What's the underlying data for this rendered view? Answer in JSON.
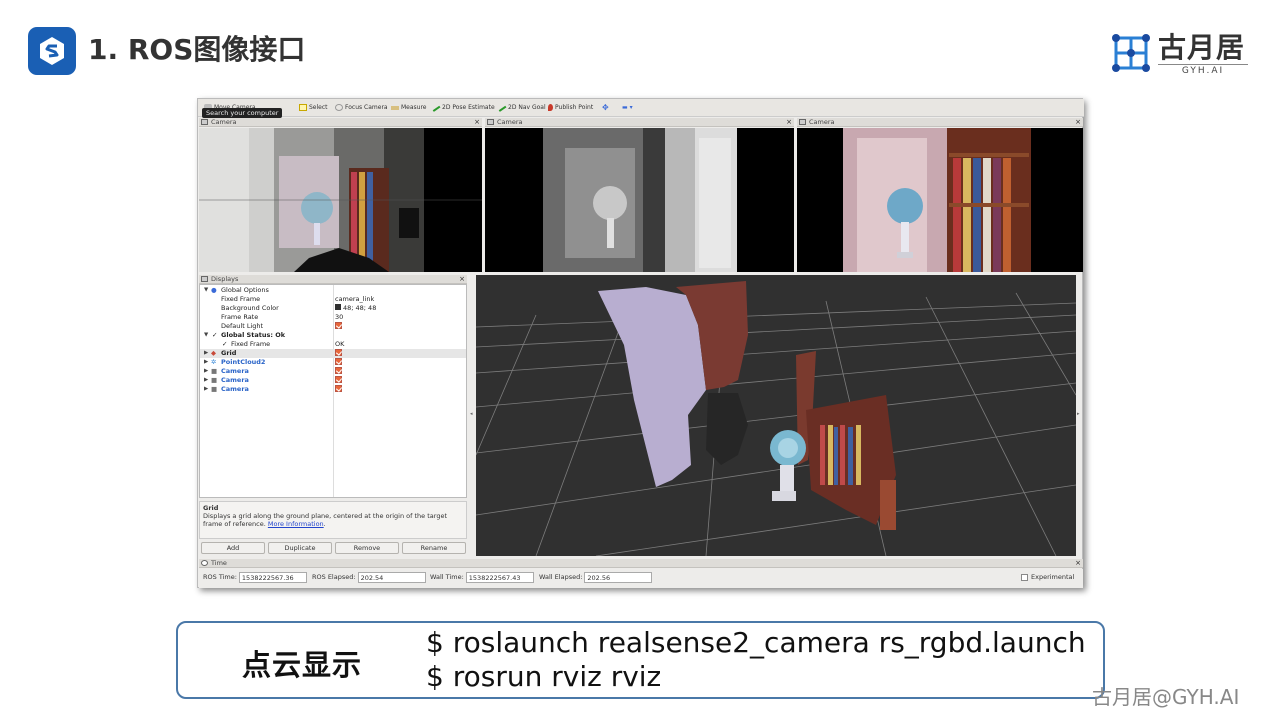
{
  "slide": {
    "title": "1. ROS图像接口",
    "brand_cn": "古月居",
    "brand_en": "GYH.AI",
    "watermark": "古月居@GYH.AI",
    "accent": "#1a5fb4",
    "box_border": "#4a78a8"
  },
  "rviz": {
    "toolbar": {
      "items": [
        "Move Camera",
        "Select",
        "Focus Camera",
        "Measure",
        "2D Pose Estimate",
        "2D Nav Goal",
        "Publish Point"
      ],
      "tooltip": "Search your computer"
    },
    "camera_panels": [
      "Camera",
      "Camera",
      "Camera"
    ],
    "displays": {
      "title": "Displays",
      "rows": [
        {
          "label": "Global Options",
          "value": ""
        },
        {
          "label": "Fixed Frame",
          "value": "camera_link"
        },
        {
          "label": "Background Color",
          "value": "48; 48; 48"
        },
        {
          "label": "Frame Rate",
          "value": "30"
        },
        {
          "label": "Default Light",
          "value": ""
        },
        {
          "label": "Global Status: Ok",
          "value": ""
        },
        {
          "label": "Fixed Frame",
          "value": "OK"
        },
        {
          "label": "Grid",
          "value": ""
        },
        {
          "label": "PointCloud2",
          "value": ""
        },
        {
          "label": "Camera",
          "value": ""
        },
        {
          "label": "Camera",
          "value": ""
        },
        {
          "label": "Camera",
          "value": ""
        }
      ],
      "description_title": "Grid",
      "description_text": "Displays a grid along the ground plane, centered at the origin of the target frame of reference.",
      "description_link": "More Information",
      "buttons": {
        "add": "Add",
        "duplicate": "Duplicate",
        "remove": "Remove",
        "rename": "Rename"
      }
    },
    "time": {
      "title": "Time",
      "ros_time_label": "ROS Time:",
      "ros_time": "1538222567.36",
      "ros_elapsed_label": "ROS Elapsed:",
      "ros_elapsed": "202.54",
      "wall_time_label": "Wall Time:",
      "wall_time": "1538222567.43",
      "wall_elapsed_label": "Wall Elapsed:",
      "wall_elapsed": "202.56",
      "experimental": "Experimental"
    }
  },
  "command_box": {
    "label": "点云显示",
    "lines": [
      "$ roslaunch realsense2_camera rs_rgbd.launch",
      "$ rosrun rviz rviz"
    ]
  }
}
